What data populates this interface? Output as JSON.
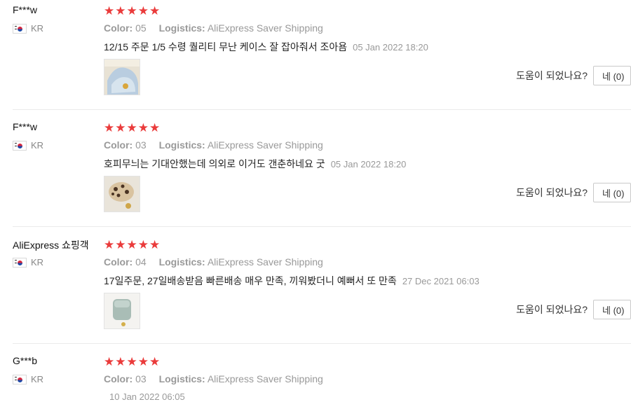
{
  "helpful_label": "도움이 되었나요?",
  "yes_label": "네 (0)",
  "stars": "★★★★★",
  "reviews": [
    {
      "user": "F***w",
      "country": "KR",
      "color_key": "Color:",
      "color_value": "05",
      "logistics_key": "Logistics:",
      "logistics_value": "AliExpress Saver Shipping",
      "text": "12/15 주문 1/5 수령 퀄리티 무난 케이스 잘 잡아줘서 조아욤",
      "date": "05 Jan 2022 18:20"
    },
    {
      "user": "F***w",
      "country": "KR",
      "color_key": "Color:",
      "color_value": "03",
      "logistics_key": "Logistics:",
      "logistics_value": "AliExpress Saver Shipping",
      "text": "호피무늬는 기대안했는데 의외로 이거도 갠춘하네요 굿",
      "date": "05 Jan 2022 18:20"
    },
    {
      "user": "AliExpress 쇼핑객",
      "country": "KR",
      "color_key": "Color:",
      "color_value": "04",
      "logistics_key": "Logistics:",
      "logistics_value": "AliExpress Saver Shipping",
      "text": "17일주문, 27일배송받음 빠른배송 매우 만족, 끼워봤더니 예뻐서 또 만족",
      "date": "27 Dec 2021 06:03"
    },
    {
      "user": "G***b",
      "country": "KR",
      "color_key": "Color:",
      "color_value": "03",
      "logistics_key": "Logistics:",
      "logistics_value": "AliExpress Saver Shipping",
      "text": "",
      "date": "10 Jan 2022 06:05"
    }
  ],
  "colors": {
    "star": "#ea3b3b",
    "muted": "#999999",
    "separator": "#ebebeb"
  }
}
